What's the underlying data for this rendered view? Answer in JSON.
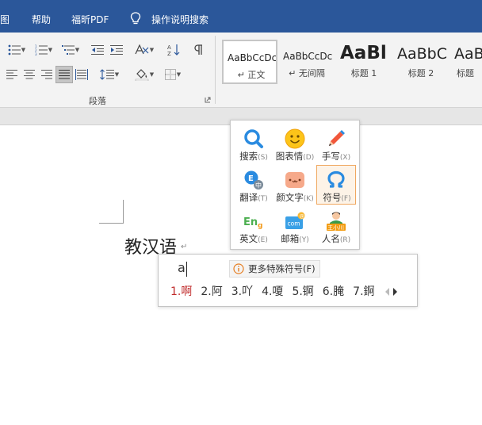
{
  "menubar": {
    "items": [
      "图",
      "帮助",
      "福昕PDF",
      "操作说明搜索"
    ]
  },
  "ribbon": {
    "group_label": "段落",
    "styles": [
      {
        "preview": "AaBbCcDc",
        "name": "↵ 正文"
      },
      {
        "preview": "AaBbCcDc",
        "name": "↵ 无间隔"
      },
      {
        "preview": "AaBl",
        "name": "标题 1"
      },
      {
        "preview": "AaBbC",
        "name": "标题 2"
      },
      {
        "preview": "AaB",
        "name": "标题"
      }
    ]
  },
  "document": {
    "text": "教汉语",
    "para_mark": "↵"
  },
  "ime_toolbox": {
    "items": [
      {
        "label": "搜索",
        "key": "(S)",
        "icon": "search-icon"
      },
      {
        "label": "图表情",
        "key": "(D)",
        "icon": "smiley-icon"
      },
      {
        "label": "手写",
        "key": "(X)",
        "icon": "pencil-icon"
      },
      {
        "label": "翻译",
        "key": "(T)",
        "icon": "translate-icon"
      },
      {
        "label": "颜文字",
        "key": "(K)",
        "icon": "kaomoji-icon"
      },
      {
        "label": "符号",
        "key": "(F)",
        "icon": "omega-icon"
      },
      {
        "label": "英文",
        "key": "(E)",
        "icon": "english-icon"
      },
      {
        "label": "邮箱",
        "key": "(Y)",
        "icon": "email-icon"
      },
      {
        "label": "人名",
        "key": "(R)",
        "icon": "person-icon"
      }
    ],
    "highlighted_index": 5,
    "person_badge": "王小川",
    "english_badge": "En",
    "email_badge": "com"
  },
  "candidate_window": {
    "composition": "a",
    "more_symbols": "更多特殊符号(F)",
    "candidates": [
      "1.啊",
      "2.阿",
      "3.吖",
      "4.嗄",
      "5.锕",
      "6.腌",
      "7.錒"
    ]
  },
  "colors": {
    "menubar": "#2b579a",
    "first_candidate": "#c02b2b",
    "highlight_border": "#f0a860"
  }
}
